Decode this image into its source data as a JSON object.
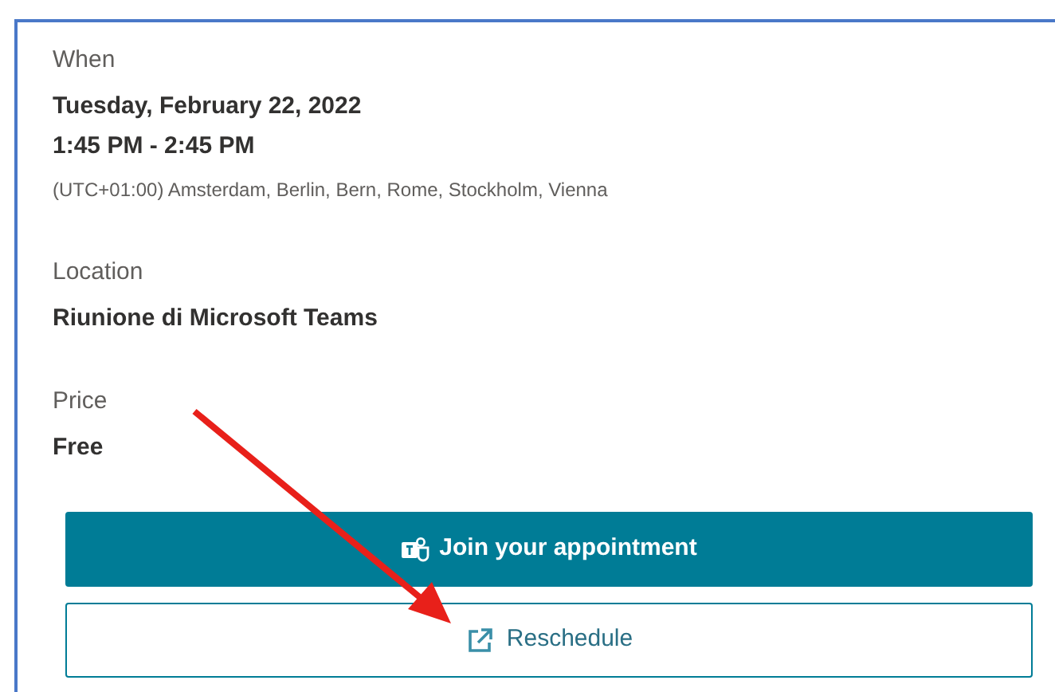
{
  "when": {
    "label": "When",
    "date": "Tuesday, February 22, 2022",
    "time": "1:45 PM - 2:45 PM",
    "timezone": "(UTC+01:00) Amsterdam, Berlin, Bern, Rome, Stockholm, Vienna"
  },
  "location": {
    "label": "Location",
    "value": "Riunione di Microsoft Teams"
  },
  "price": {
    "label": "Price",
    "value": "Free"
  },
  "buttons": [
    {
      "kind": "primary",
      "label": "Join your appointment"
    },
    {
      "kind": "secondary",
      "label": "Reschedule"
    }
  ]
}
